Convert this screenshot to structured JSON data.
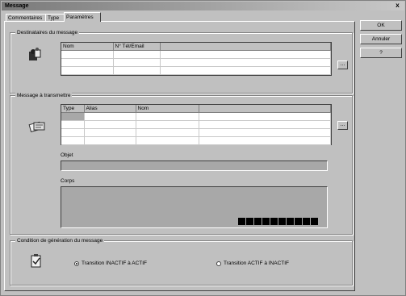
{
  "window": {
    "title": "Message",
    "close_glyph": "x"
  },
  "tabs": [
    {
      "label": "Commentaires"
    },
    {
      "label": "Type"
    },
    {
      "label": "Paramètres"
    }
  ],
  "buttons": {
    "ok": "OK",
    "cancel": "Annuler",
    "help": "?"
  },
  "recipients": {
    "title": "Destinataires du message",
    "columns": [
      "Nom",
      "N° Tél/Email"
    ],
    "browse_label": "..."
  },
  "message": {
    "title": "Message à transmettre",
    "columns": [
      "Type",
      "Alias",
      "Nom"
    ],
    "browse_label": "...",
    "subject_label": "Objet",
    "body_label": "Corps"
  },
  "condition": {
    "title": "Condition de génération du message",
    "options": [
      {
        "label": "Transition INACTIF à ACTIF",
        "selected": true
      },
      {
        "label": "Transition ACTIF à INACTIF",
        "selected": false
      }
    ]
  },
  "icons": {
    "recipients": "people-icon",
    "message": "message-cards-icon",
    "condition": "clipboard-check-icon"
  }
}
